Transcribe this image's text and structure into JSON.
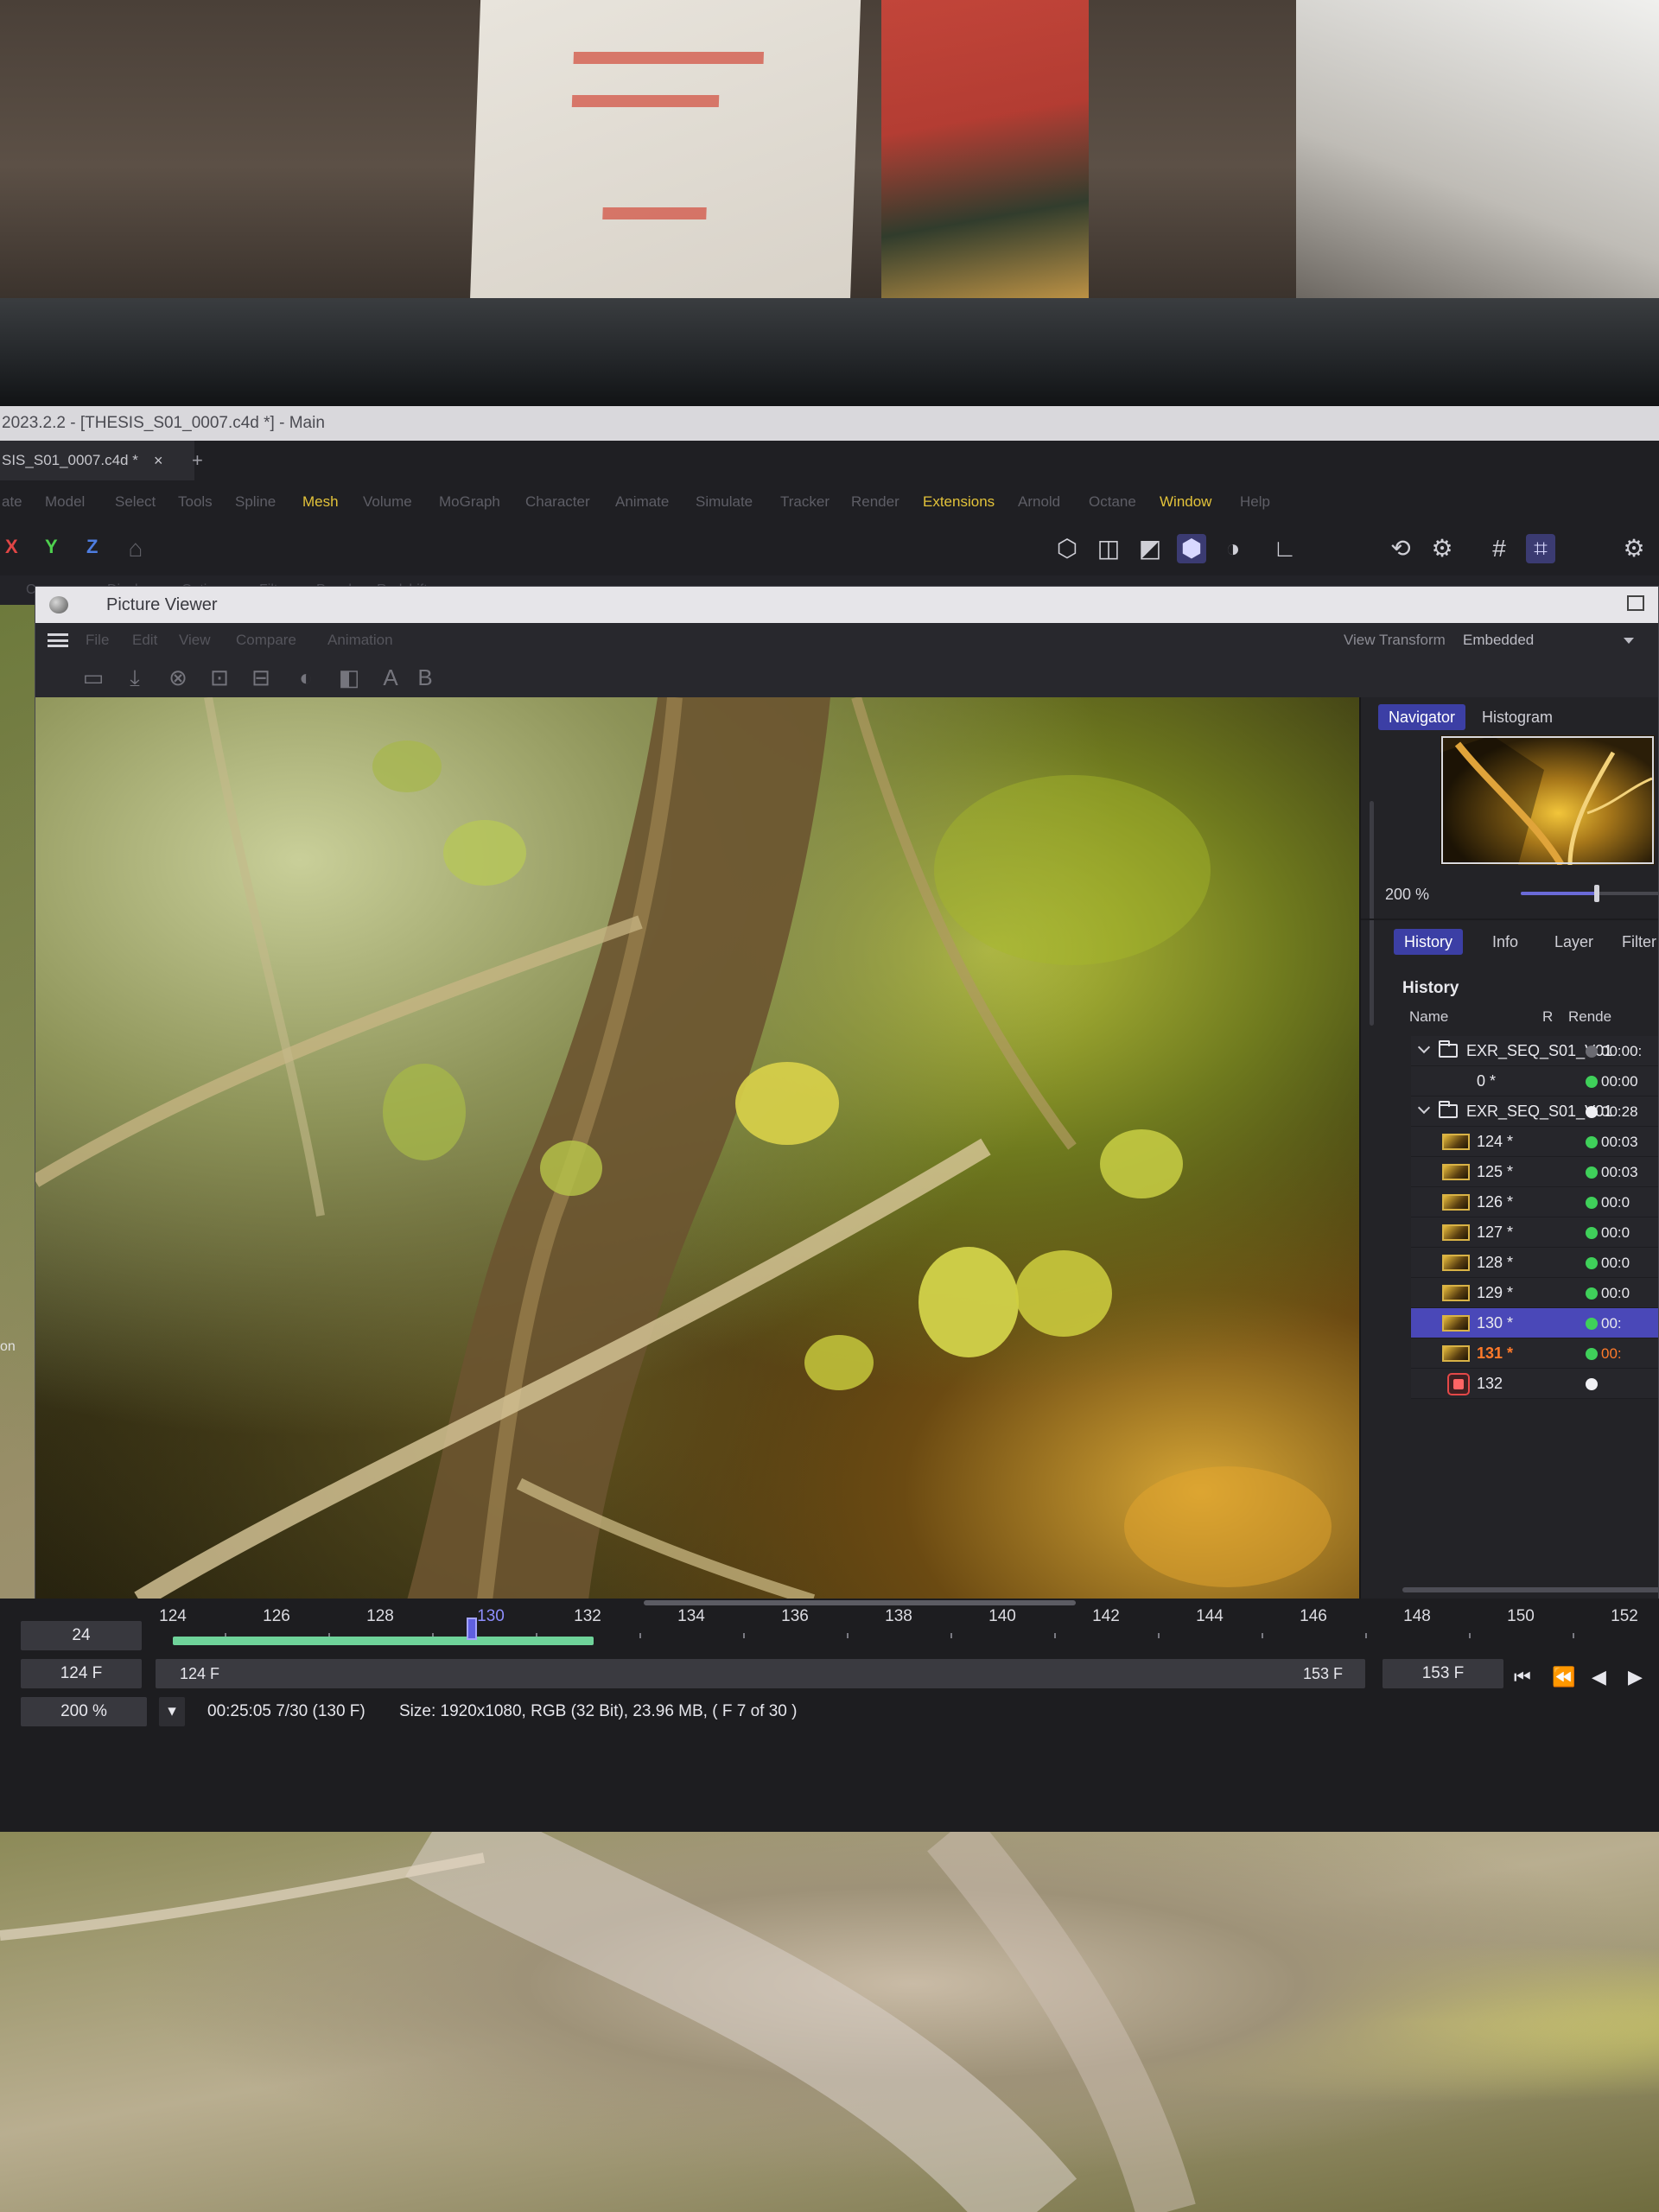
{
  "cinema4d": {
    "window_title": "2023.2.2 - [THESIS_S01_0007.c4d *] - Main",
    "doc_tab": "SIS_S01_0007.c4d *",
    "doc_tab_close": "×",
    "doc_tab_add": "+",
    "menu": [
      "ate",
      "Model",
      "Select",
      "Tools",
      "Spline",
      "Mesh",
      "Volume",
      "MoGraph",
      "Character",
      "Animate",
      "Simulate",
      "Tracker",
      "Render",
      "Extensions",
      "Arnold",
      "Octane",
      "Window",
      "Help"
    ],
    "menu_highlight": [
      "Mesh",
      "Extensions",
      "Window"
    ],
    "axes": [
      "X",
      "Y",
      "Z"
    ],
    "sub_toolbar": [
      "Cameras",
      "Display",
      "Options",
      "Filter",
      "Panel",
      "Redshift"
    ],
    "viewport_side_text": "on"
  },
  "picture_viewer": {
    "title": "Picture Viewer",
    "menu": [
      "File",
      "Edit",
      "View",
      "Compare",
      "Animation"
    ],
    "view_transform_label": "View Transform",
    "view_transform_value": "Embedded",
    "tools_ab": [
      "A",
      "B"
    ],
    "navigator": {
      "tabs": [
        "Navigator",
        "Histogram"
      ],
      "active_tab": "Navigator",
      "zoom": "200 %",
      "zoom_slider_level": 0.55
    },
    "info_tabs": [
      "History",
      "Info",
      "Layer",
      "Filter"
    ],
    "active_info_tab": "History",
    "history": {
      "title": "History",
      "columns": [
        "Name",
        "R",
        "Rende"
      ],
      "rows": [
        {
          "indent": 0,
          "type": "folder",
          "label": "EXR_SEQ_S01_V01",
          "dot": "grey",
          "time": "00:00:",
          "expanded": true
        },
        {
          "indent": 1,
          "type": "blank",
          "label": "0 *",
          "dot": "green",
          "time": "00:00"
        },
        {
          "indent": 0,
          "type": "folder",
          "label": "EXR_SEQ_S01_V01",
          "dot": "white",
          "time": "00:28",
          "expanded": true
        },
        {
          "indent": 1,
          "type": "frame",
          "label": "124 *",
          "dot": "green",
          "time": "00:03"
        },
        {
          "indent": 1,
          "type": "frame",
          "label": "125 *",
          "dot": "green",
          "time": "00:03"
        },
        {
          "indent": 1,
          "type": "frame",
          "label": "126 *",
          "dot": "green",
          "time": "00:0"
        },
        {
          "indent": 1,
          "type": "frame",
          "label": "127 *",
          "dot": "green",
          "time": "00:0"
        },
        {
          "indent": 1,
          "type": "frame",
          "label": "128 *",
          "dot": "green",
          "time": "00:0"
        },
        {
          "indent": 1,
          "type": "frame",
          "label": "129 *",
          "dot": "green",
          "time": "00:0"
        },
        {
          "indent": 1,
          "type": "frame",
          "label": "130 *",
          "dot": "green",
          "time": "00:",
          "selected": true
        },
        {
          "indent": 1,
          "type": "frame",
          "label": "131 *",
          "dot": "green",
          "time": "00:",
          "current": true
        },
        {
          "indent": 1,
          "type": "render",
          "label": "132",
          "dot": "white",
          "time": ""
        }
      ]
    },
    "timeline": {
      "current_frame": "24",
      "start_field": "124 F",
      "zoom": "200 %",
      "range_start": "124 F",
      "range_end": "153 F",
      "end_field": "153 F",
      "tick_labels": [
        "124",
        "126",
        "128",
        "130",
        "132",
        "134",
        "136",
        "138",
        "140",
        "142",
        "144",
        "146",
        "148",
        "150",
        "152"
      ],
      "cursor_label": "130",
      "rendered_through_fraction": 0.29,
      "status_time": "00:25:05 7/30 (130 F)",
      "status_info": "Size: 1920x1080, RGB (32 Bit), 23.96 MB,  ( F 7 of 30 )"
    }
  },
  "colors": {
    "accent": "#3c3fa5",
    "selection": "#4a48b8",
    "highlight_menu": "#e2c23a",
    "current_frame_text": "#ff7a2a",
    "played_bar": "#6fd39a"
  }
}
